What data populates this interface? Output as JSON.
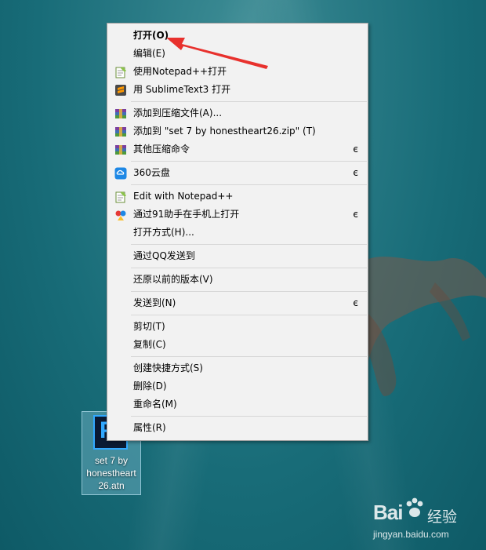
{
  "context_menu": {
    "groups": [
      [
        {
          "label": "打开(O)",
          "icon": "",
          "bold": true,
          "submenu": false
        },
        {
          "label": "编辑(E)",
          "icon": "",
          "bold": false,
          "submenu": false
        },
        {
          "label": "使用Notepad++打开",
          "icon": "notepad-plus-plus-icon",
          "bold": false,
          "submenu": false
        },
        {
          "label": "用 SublimeText3 打开",
          "icon": "sublime-text-icon",
          "bold": false,
          "submenu": false
        }
      ],
      [
        {
          "label": "添加到压缩文件(A)...",
          "icon": "winrar-icon",
          "bold": false,
          "submenu": false
        },
        {
          "label": "添加到 \"set 7 by honestheart26.zip\" (T)",
          "icon": "winrar-icon",
          "bold": false,
          "submenu": false
        },
        {
          "label": "其他压缩命令",
          "icon": "winrar-icon",
          "bold": false,
          "submenu": true
        }
      ],
      [
        {
          "label": "360云盘",
          "icon": "360-cloud-icon",
          "bold": false,
          "submenu": true
        }
      ],
      [
        {
          "label": "Edit with Notepad++",
          "icon": "notepad-plus-plus-icon",
          "bold": false,
          "submenu": false
        },
        {
          "label": "通过91助手在手机上打开",
          "icon": "assistant-91-icon",
          "bold": false,
          "submenu": true
        },
        {
          "label": "打开方式(H)...",
          "icon": "",
          "bold": false,
          "submenu": false
        }
      ],
      [
        {
          "label": "通过QQ发送到",
          "icon": "",
          "bold": false,
          "submenu": false
        }
      ],
      [
        {
          "label": "还原以前的版本(V)",
          "icon": "",
          "bold": false,
          "submenu": false
        }
      ],
      [
        {
          "label": "发送到(N)",
          "icon": "",
          "bold": false,
          "submenu": true
        }
      ],
      [
        {
          "label": "剪切(T)",
          "icon": "",
          "bold": false,
          "submenu": false
        },
        {
          "label": "复制(C)",
          "icon": "",
          "bold": false,
          "submenu": false
        }
      ],
      [
        {
          "label": "创建快捷方式(S)",
          "icon": "",
          "bold": false,
          "submenu": false
        },
        {
          "label": "删除(D)",
          "icon": "",
          "bold": false,
          "submenu": false
        },
        {
          "label": "重命名(M)",
          "icon": "",
          "bold": false,
          "submenu": false
        }
      ],
      [
        {
          "label": "属性(R)",
          "icon": "",
          "bold": false,
          "submenu": false
        }
      ]
    ],
    "submenu_glyph": "є"
  },
  "desktop_icon": {
    "logo_text": "P",
    "label_lines": [
      "set 7 by",
      "honestheart",
      "26.atn"
    ]
  },
  "watermark": {
    "brand": "Bai",
    "brand_cn": "经验",
    "url": "jingyan.baidu.com"
  },
  "colors": {
    "arrow": "#e8312d",
    "menu_bg": "#f2f2f2",
    "ps_blue": "#31a8ff"
  }
}
